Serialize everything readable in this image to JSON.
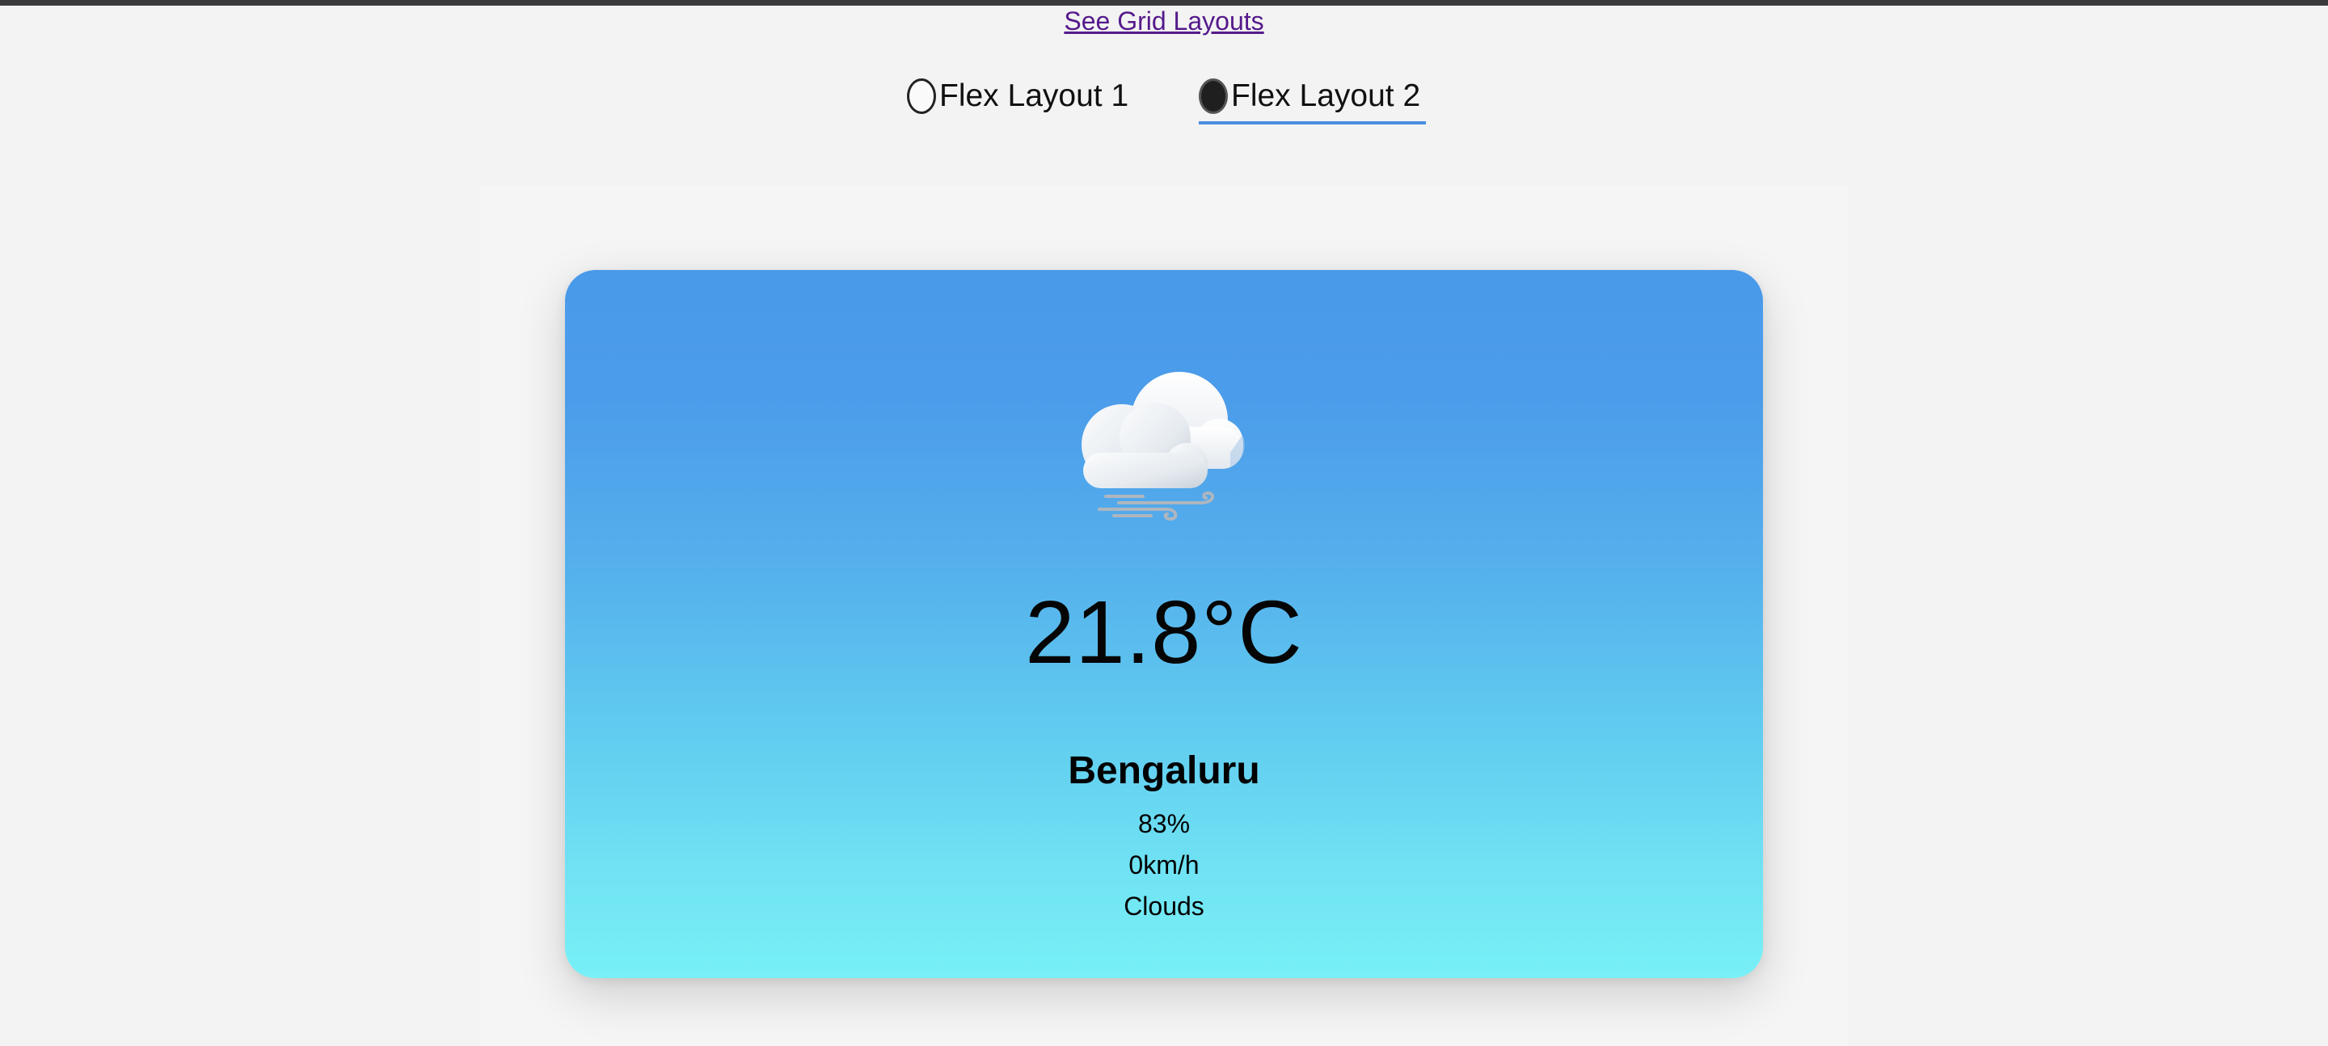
{
  "nav": {
    "grid_link": "See Grid Layouts"
  },
  "layout_tabs": [
    {
      "label": "Flex Layout 1",
      "selected": false
    },
    {
      "label": "Flex Layout 2",
      "selected": true
    }
  ],
  "weather": {
    "icon": "cloudy-wind-icon",
    "temperature": "21.8°C",
    "city": "Bengaluru",
    "humidity": "83%",
    "wind_speed": "0km/h",
    "condition": "Clouds"
  },
  "colors": {
    "card_gradient_top": "#4a9aea",
    "card_gradient_bottom": "#78f0f6",
    "tab_underline": "#4a8fe0",
    "link": "#551a8b"
  }
}
